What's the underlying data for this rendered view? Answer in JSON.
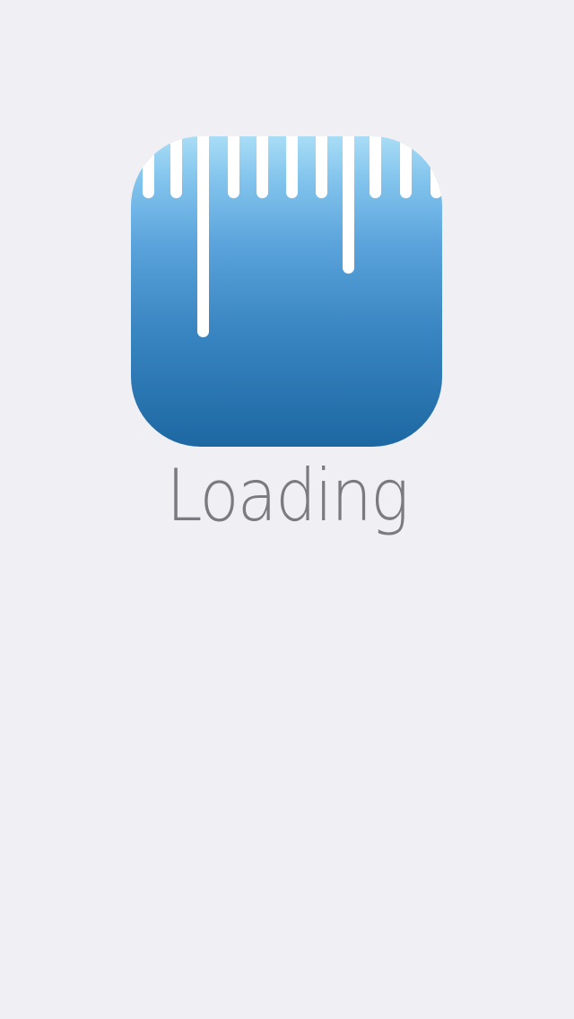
{
  "splash": {
    "status_text": "Loading",
    "icon_name": "ruler-icon"
  },
  "colors": {
    "background": "#efeff4",
    "icon_gradient_top": "#a9ddf6",
    "icon_gradient_bottom": "#1d68a3",
    "ticks": "#ffffff",
    "status_text": "#7a7a7f"
  }
}
